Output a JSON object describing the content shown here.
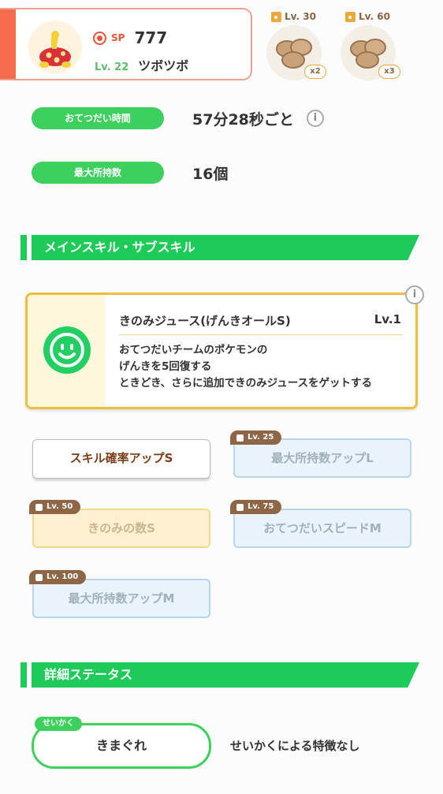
{
  "header": {
    "sp_label": "SP",
    "sp_value": "777",
    "level": "Lv. 22",
    "name": "ツボツボ",
    "ingredients": [
      {
        "unlock": "Lv. 30",
        "qty": "x2"
      },
      {
        "unlock": "Lv. 60",
        "qty": "x3"
      }
    ]
  },
  "stats": {
    "help_time_label": "おてつだい時間",
    "help_time_value": "57分28秒ごと",
    "max_carry_label": "最大所持数",
    "max_carry_value": "16個"
  },
  "skills_section": {
    "title": "メインスキル・サブスキル"
  },
  "main_skill": {
    "name": "きのみジュース(げんきオールS)",
    "level": "Lv.1",
    "desc_line1": "おてつだいチームのポケモンの",
    "desc_line2": "げんきを5回復する",
    "desc_line3": "ときどき、さらに追加できのみジュースをゲットする",
    "info": "i"
  },
  "sub_skills": [
    {
      "label": "スキル確率アップS",
      "unlock": ""
    },
    {
      "label": "最大所持数アップL",
      "unlock": "Lv. 25"
    },
    {
      "label": "きのみの数S",
      "unlock": "Lv. 50"
    },
    {
      "label": "おてつだいスピードM",
      "unlock": "Lv. 75"
    },
    {
      "label": "最大所持数アップM",
      "unlock": "Lv. 100"
    }
  ],
  "details_section": {
    "title": "詳細ステータス"
  },
  "nature": {
    "tag": "せいかく",
    "value": "きまぐれ",
    "effect": "せいかくによる特徴なし"
  },
  "info_icon": "i",
  "colors": {
    "accent_green": "#1ecb58",
    "header_stripe": "#f56b4e",
    "skill_border": "#eebf3d",
    "sub_skill_text": "#7a3e1b"
  }
}
